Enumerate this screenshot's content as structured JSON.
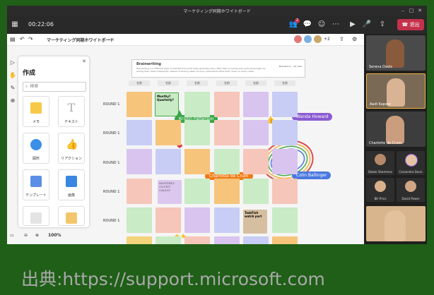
{
  "window": {
    "title": "マーケティング同期ホワイトボード"
  },
  "toolbar": {
    "timer": "00:22:06",
    "leave_label": "退出",
    "notification_count": "2"
  },
  "board": {
    "title": "マーケティング同期ホワイトボード",
    "participant_extra": "+2",
    "zoom": "100%",
    "brainstorm_title": "Brainwriting",
    "brainstorm_text": "Brainwriting is a different style of brainstorming that helps generate many ideas fast by having each participant begin by writing their ideas individually. Instead of sharing ideas out loud, participants write them down on sticky notes.",
    "row_labels": [
      "ROUND 1",
      "ROUND 1",
      "ROUND 1",
      "ROUND 1",
      "ROUND 1"
    ],
    "col_headers": [
      "名前",
      "名前",
      "名前",
      "名前",
      "名前",
      "名前"
    ],
    "sticky_monthly": "Monthy? Quarterly?",
    "sticky_handwritten": "MONTHLY COUNT CALLS?",
    "sticky_taskfish": "TaskFish watch part",
    "brainstorm_btn1": "Brainstorm",
    "brainstorm_btn2": "Alt view"
  },
  "panel": {
    "title": "作成",
    "search_placeholder": "検索",
    "tiles": [
      {
        "label": "メモ",
        "color": "#f7c948"
      },
      {
        "label": "テキスト",
        "color": "#bdbdbd"
      },
      {
        "label": "図形",
        "color": "#3b8fe8"
      },
      {
        "label": "リアクション",
        "color": "#f5b700"
      },
      {
        "label": "テンプレート",
        "color": "#5b8ee6"
      },
      {
        "label": "画像",
        "color": "#3a86e0"
      }
    ]
  },
  "cursors": [
    {
      "name": "Kristin Patterson",
      "color": "#3aa648"
    },
    {
      "name": "Wanda Howard",
      "color": "#8b5bd1"
    },
    {
      "name": "Charlotte de Crum",
      "color": "#f07a12"
    },
    {
      "name": "Colin Ballinger",
      "color": "#4a78e0"
    }
  ],
  "participants": {
    "large": [
      "Serena Davis",
      "Aadi Kapoor",
      "Charlotte de Crum"
    ],
    "small": [
      "Babak Shammas",
      "Cassandra Dunn",
      "Bill Price",
      "David Power"
    ]
  },
  "credit": "出典:https://support.microsoft.com",
  "colors": {
    "accent": "#c4314b",
    "background": "#1f5f17"
  }
}
